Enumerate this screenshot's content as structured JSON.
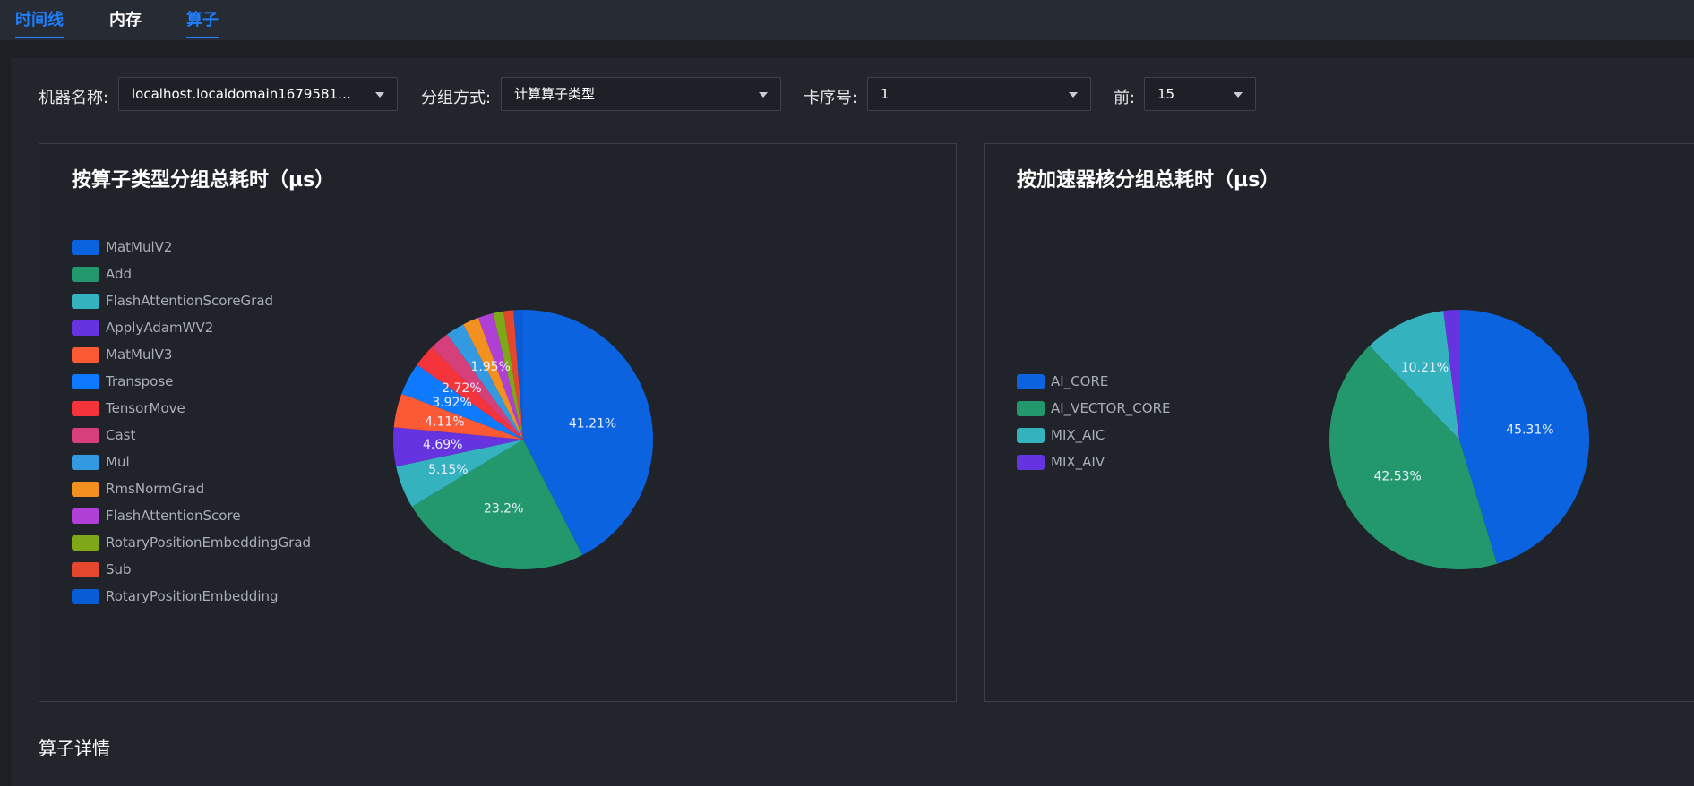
{
  "tabs": [
    {
      "label": "时间线",
      "active": true
    },
    {
      "label": "内存",
      "active": false
    },
    {
      "label": "算子",
      "active": true
    }
  ],
  "filters": {
    "machine": {
      "label": "机器名称:",
      "value": "localhost.localdomain1679581769..."
    },
    "group": {
      "label": "分组方式:",
      "value": "计算算子类型"
    },
    "card": {
      "label": "卡序号:",
      "value": "1"
    },
    "top": {
      "label": "前:",
      "value": "15"
    }
  },
  "panels": {
    "left_title": "按算子类型分组总耗时（µs）",
    "right_title": "按加速器核分组总耗时（µs）"
  },
  "chart_data": [
    {
      "type": "pie",
      "title": "按算子类型分组总耗时（µs）",
      "slices": [
        {
          "label": "MatMulV2",
          "value": 41.21,
          "color": "#0b63e0",
          "data_label": "41.21%"
        },
        {
          "label": "Add",
          "value": 23.2,
          "color": "#23986d",
          "data_label": "23.2%"
        },
        {
          "label": "FlashAttentionScoreGrad",
          "value": 5.15,
          "color": "#34b3bf",
          "data_label": "5.15%"
        },
        {
          "label": "ApplyAdamWV2",
          "value": 4.69,
          "color": "#6633e0",
          "data_label": "4.69%"
        },
        {
          "label": "MatMulV3",
          "value": 4.11,
          "color": "#fb5a35",
          "data_label": "4.11%"
        },
        {
          "label": "Transpose",
          "value": 3.92,
          "color": "#0d7aff",
          "data_label": "3.92%"
        },
        {
          "label": "TensorMove",
          "value": 2.72,
          "color": "#f5333b",
          "data_label": "2.72%"
        },
        {
          "label": "Cast",
          "value": 2.4,
          "color": "#d6407a",
          "data_label": ""
        },
        {
          "label": "Mul",
          "value": 2.25,
          "color": "#3399e0",
          "data_label": ""
        },
        {
          "label": "RmsNormGrad",
          "value": 1.95,
          "color": "#f2911f",
          "data_label": "1.95%"
        },
        {
          "label": "FlashAttentionScore",
          "value": 1.85,
          "color": "#b03fd6",
          "data_label": ""
        },
        {
          "label": "RotaryPositionEmbeddingGrad",
          "value": 1.25,
          "color": "#7fa819",
          "data_label": ""
        },
        {
          "label": "Sub",
          "value": 1.2,
          "color": "#e5472e",
          "data_label": ""
        },
        {
          "label": "RotaryPositionEmbedding",
          "value": 1.15,
          "color": "#0a5cd6",
          "data_label": ""
        }
      ]
    },
    {
      "type": "pie",
      "title": "按加速器核分组总耗时（µs）",
      "slices": [
        {
          "label": "AI_CORE",
          "value": 45.31,
          "color": "#0b63e0",
          "data_label": "45.31%"
        },
        {
          "label": "AI_VECTOR_CORE",
          "value": 42.53,
          "color": "#23986d",
          "data_label": "42.53%"
        },
        {
          "label": "MIX_AIC",
          "value": 10.21,
          "color": "#34b3bf",
          "data_label": "10.21%"
        },
        {
          "label": "MIX_AIV",
          "value": 1.95,
          "color": "#6633e0",
          "data_label": ""
        }
      ]
    }
  ],
  "section_title": "算子详情"
}
